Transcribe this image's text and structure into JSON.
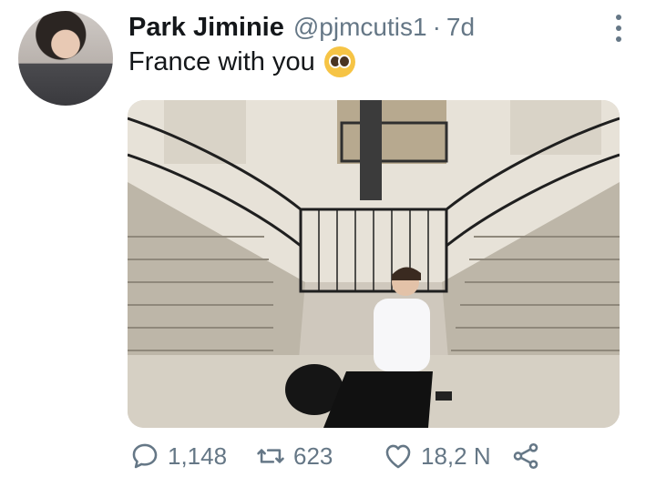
{
  "tweet": {
    "display_name": "Park Jiminie",
    "handle": "@pjmcutis1",
    "separator": "·",
    "time": "7d",
    "text": "France with you",
    "emoji": "pleading-face-emoji"
  },
  "actions": {
    "replies": "1,148",
    "retweets": "623",
    "likes": "18,2 N"
  },
  "icons": {
    "reply": "speech-bubble-icon",
    "retweet": "retweet-icon",
    "like": "heart-icon",
    "share": "share-icon",
    "more": "vertical-ellipsis-icon"
  },
  "colors": {
    "text": "#14171a",
    "muted": "#657786"
  }
}
